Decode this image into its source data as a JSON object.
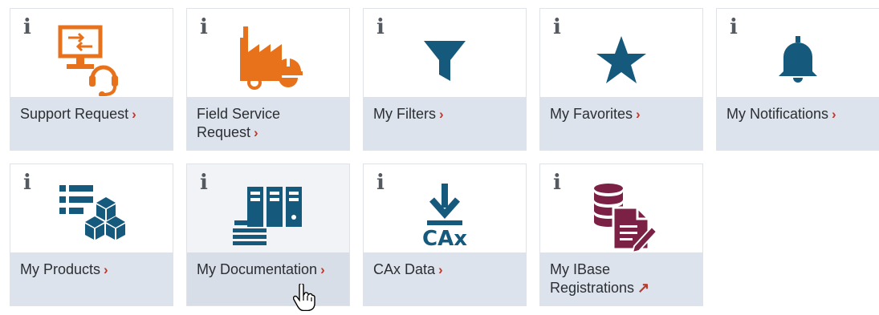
{
  "tiles": [
    {
      "id": "support-request",
      "label": "Support Request",
      "suffix": "›",
      "icon": "support-icon",
      "info": "i"
    },
    {
      "id": "field-service-request",
      "label_lines": [
        "Field Service",
        "Request"
      ],
      "suffix": "›",
      "icon": "factory-service-icon",
      "info": "i"
    },
    {
      "id": "my-filters",
      "label": "My Filters",
      "suffix": "›",
      "icon": "filter-icon",
      "info": "i"
    },
    {
      "id": "my-favorites",
      "label": "My Favorites",
      "suffix": "›",
      "icon": "star-icon",
      "info": "i"
    },
    {
      "id": "my-notifications",
      "label": "My Notifications",
      "suffix": "›",
      "icon": "bell-icon",
      "info": "i"
    },
    {
      "id": "my-products",
      "label": "My Products",
      "suffix": "›",
      "icon": "products-icon",
      "info": "i"
    },
    {
      "id": "my-documentation",
      "label": "My Documentation",
      "suffix": "›",
      "icon": "documentation-icon",
      "info": "i"
    },
    {
      "id": "cax-data",
      "label": "CAx Data",
      "suffix": "›",
      "icon": "cax-download-icon",
      "icon_text": "CAx",
      "info": "i"
    },
    {
      "id": "my-ibase-registrations",
      "label_lines": [
        "My IBase",
        "Registrations"
      ],
      "suffix": "↗",
      "icon": "database-document-icon",
      "info": "i"
    }
  ],
  "colors": {
    "orange": "#e8711c",
    "teal": "#15597c",
    "maroon": "#7b2146",
    "footer_bg": "#dde3ec",
    "chevron": "#c0392b"
  },
  "cursor": {
    "icon": "hand-pointer-icon"
  }
}
